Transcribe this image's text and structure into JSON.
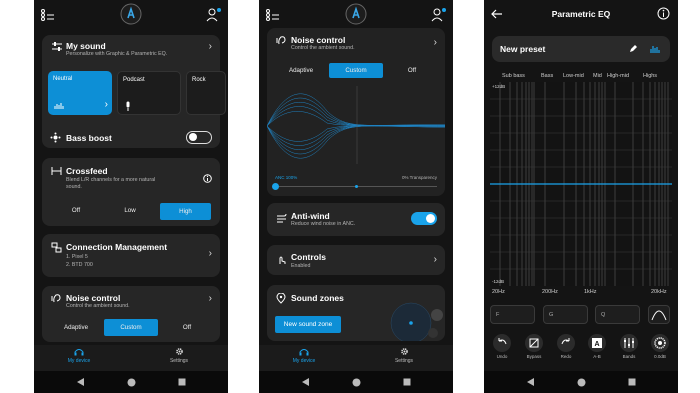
{
  "screen1": {
    "my_sound": {
      "title": "My sound",
      "subtitle": "Personalize with Graphic & Parametric EQ."
    },
    "presets": [
      {
        "label": "Neutral"
      },
      {
        "label": "Podcast"
      },
      {
        "label": "Rock"
      }
    ],
    "bass_boost": {
      "label": "Bass boost",
      "on": false
    },
    "crossfeed": {
      "title": "Crossfeed",
      "line1": "Blend L/R channels for a more natural",
      "line2": "sound.",
      "options": [
        "Off",
        "Low",
        "High"
      ],
      "selected": "High"
    },
    "connection": {
      "title": "Connection Management",
      "line1": "1. Pixel 5",
      "line2": "2. BTD 700"
    },
    "noise_control": {
      "title": "Noise control",
      "subtitle": "Control the ambient sound.",
      "options": [
        "Adaptive",
        "Custom",
        "Off"
      ],
      "selected": "Custom"
    },
    "nav": {
      "my_device": "My device",
      "settings": "Settings"
    }
  },
  "screen2": {
    "noise_control": {
      "title": "Noise control",
      "subtitle": "Control the ambient sound.",
      "options": [
        "Adaptive",
        "Custom",
        "Off"
      ],
      "selected": "Custom"
    },
    "anc_label": "ANC 100%",
    "transparency_label": "0% Transparency",
    "anti_wind": {
      "title": "Anti-wind",
      "subtitle": "Reduce wind noise in ANC.",
      "on": true
    },
    "controls": {
      "title": "Controls",
      "subtitle": "Enabled"
    },
    "sound_zones": {
      "title": "Sound zones",
      "button": "New sound zone"
    },
    "nav": {
      "my_device": "My device",
      "settings": "Settings"
    }
  },
  "screen3": {
    "title": "Parametric EQ",
    "preset_name": "New preset",
    "bands": [
      "Sub bass",
      "Bass",
      "Low-mid",
      "Mid",
      "High-mid",
      "Highs"
    ],
    "db_top": "+12dB",
    "db_bottom": "-12dB",
    "freqs": [
      "20Hz",
      "200Hz",
      "1kHz",
      "20kHz"
    ],
    "fields": [
      "F",
      "G",
      "Q"
    ],
    "tools": [
      "Undo",
      "Bypass",
      "Redo",
      "A-B",
      "Bands",
      "0.0dB"
    ]
  },
  "colors": {
    "accent": "#0d8fd6",
    "background": "#141414",
    "card": "#262626"
  }
}
